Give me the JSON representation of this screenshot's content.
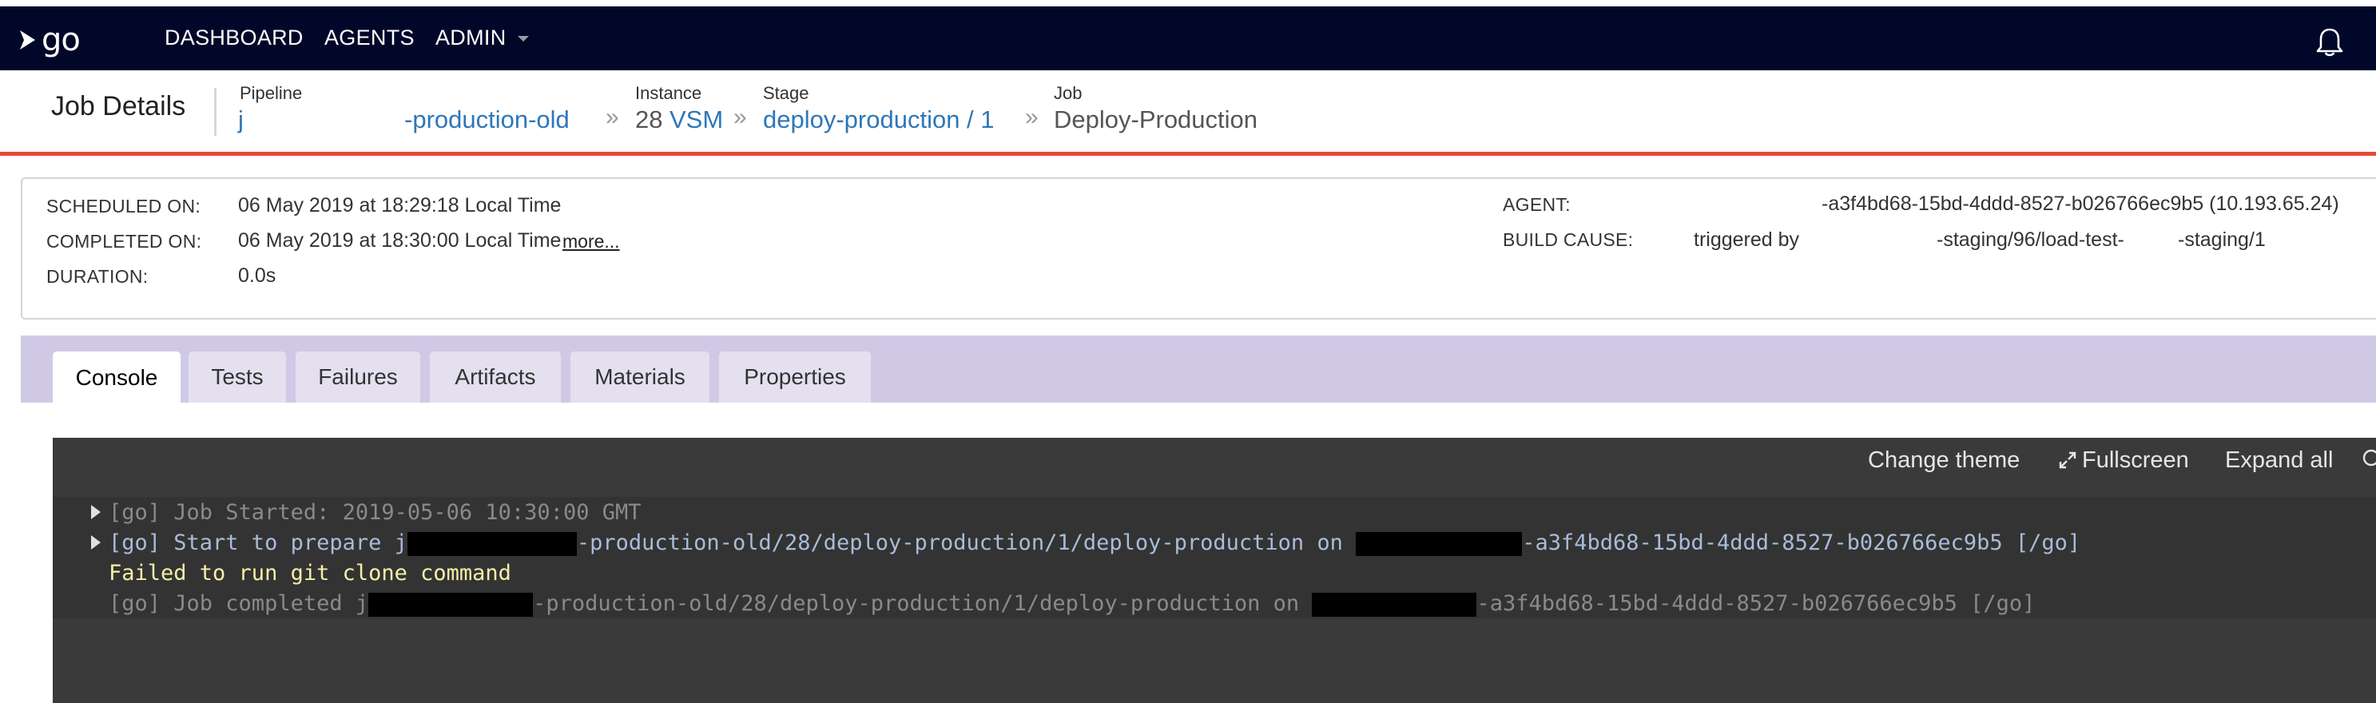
{
  "nav": {
    "logo": "go",
    "links": [
      "DASHBOARD",
      "AGENTS",
      "ADMIN"
    ]
  },
  "job_header": {
    "title": "Job Details",
    "pipeline_label": "Pipeline",
    "pipeline_prefix": "j",
    "pipeline_value": "-production-old",
    "instance_label": "Instance",
    "instance_number": "28",
    "instance_vsm": "VSM",
    "stage_label": "Stage",
    "stage_value": "deploy-production / 1",
    "job_label": "Job",
    "job_value": "Deploy-Production"
  },
  "summary": {
    "scheduled_label": "SCHEDULED ON:",
    "scheduled_value": "06 May 2019 at 18:29:18 Local Time",
    "completed_label": "COMPLETED ON:",
    "completed_value": "06 May 2019 at 18:30:00 Local Time",
    "more": "more...",
    "duration_label": "DURATION:",
    "duration_value": "0.0s",
    "agent_label": "AGENT:",
    "agent_value": "-a3f4bd68-15bd-4ddd-8527-b026766ec9b5 (10.193.65.24)",
    "build_cause_label": "BUILD CAUSE:",
    "build_cause_prefix": "triggered by",
    "build_cause_mid": "-staging/96/load-test-",
    "build_cause_end": "-staging/1"
  },
  "tabs": [
    "Console",
    "Tests",
    "Failures",
    "Artifacts",
    "Materials",
    "Properties"
  ],
  "console": {
    "change_theme": "Change theme",
    "fullscreen": "Fullscreen",
    "expand_all": "Expand all",
    "line1": "[go] Job Started: 2019-05-06 10:30:00 GMT",
    "line2_a": "[go] Start to prepare j",
    "line2_b": "-production-old/28/deploy-production/1/deploy-production on ",
    "line2_c": "-a3f4bd68-15bd-4ddd-8527-b026766ec9b5 [/go]",
    "line3": "Failed to run git clone command",
    "line4_a": "[go] Job completed j",
    "line4_b": "-production-old/28/deploy-production/1/deploy-production on ",
    "line4_c": "-a3f4bd68-15bd-4ddd-8527-b026766ec9b5 [/go]"
  },
  "colors": {
    "nav_bg": "#000728",
    "accent_red": "#e8473a",
    "link_blue": "#2e77b8",
    "tabs_band": "#d0c9e6",
    "console_bg": "#3a3a3a"
  }
}
